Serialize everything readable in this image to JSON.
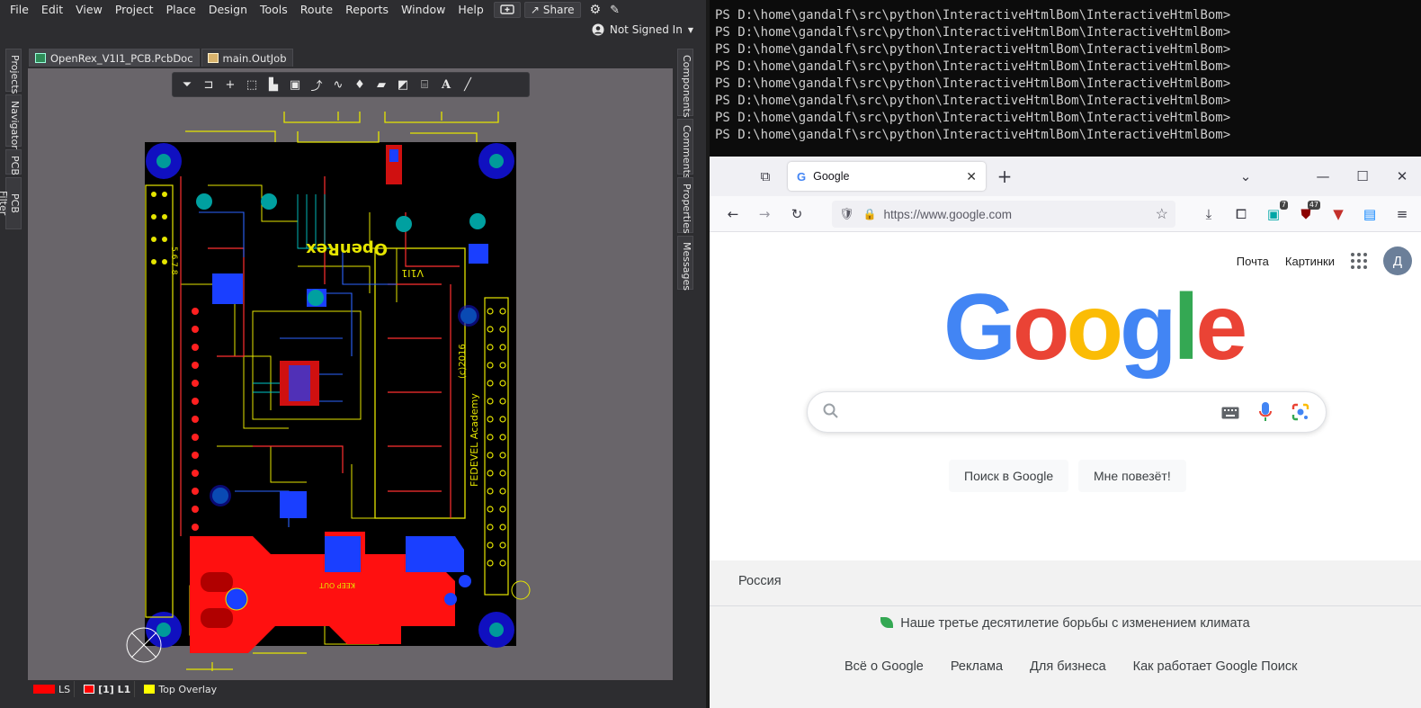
{
  "altium": {
    "menu": [
      "File",
      "Edit",
      "View",
      "Project",
      "Place",
      "Design",
      "Tools",
      "Route",
      "Reports",
      "Window",
      "Help"
    ],
    "share_label": "Share",
    "signin_label": "Not Signed In",
    "left_panels": [
      "Projects",
      "Navigator",
      "PCB",
      "PCB Filter"
    ],
    "right_panels": [
      "Components",
      "Comments",
      "Properties",
      "Messages"
    ],
    "doc_tabs": [
      "OpenRex_V1I1_PCB.PcbDoc",
      "main.OutJob"
    ],
    "pcb_text": {
      "board_name": "OpenRex",
      "version": "V1I1",
      "credit_line1": "FEDEVEL Academy",
      "credit_line2": "(c)2016",
      "keep_out": "KEEP OUT",
      "pin_digits": "5 6 7 8"
    },
    "layers": [
      {
        "label": "LS",
        "color": "#ff0000"
      },
      {
        "label": "[1] L1",
        "color": "#ff0000"
      },
      {
        "label": "Top Overlay",
        "color": "#ffff00"
      }
    ]
  },
  "terminal": {
    "lines": [
      "PS D:\\home\\gandalf\\src\\python\\InteractiveHtmlBom\\InteractiveHtmlBom>",
      "PS D:\\home\\gandalf\\src\\python\\InteractiveHtmlBom\\InteractiveHtmlBom>",
      "PS D:\\home\\gandalf\\src\\python\\InteractiveHtmlBom\\InteractiveHtmlBom>",
      "PS D:\\home\\gandalf\\src\\python\\InteractiveHtmlBom\\InteractiveHtmlBom>",
      "PS D:\\home\\gandalf\\src\\python\\InteractiveHtmlBom\\InteractiveHtmlBom>",
      "PS D:\\home\\gandalf\\src\\python\\InteractiveHtmlBom\\InteractiveHtmlBom>",
      "PS D:\\home\\gandalf\\src\\python\\InteractiveHtmlBom\\InteractiveHtmlBom>",
      "PS D:\\home\\gandalf\\src\\python\\InteractiveHtmlBom\\InteractiveHtmlBom>"
    ]
  },
  "firefox": {
    "tab_title": "Google",
    "url": "https://www.google.com",
    "extension_badges": {
      "first": "7",
      "second": "47"
    }
  },
  "google": {
    "top_links": [
      "Почта",
      "Картинки"
    ],
    "avatar_letter": "Д",
    "logo_letters": [
      {
        "ch": "G",
        "color": "#4285F4"
      },
      {
        "ch": "o",
        "color": "#EA4335"
      },
      {
        "ch": "o",
        "color": "#FBBC05"
      },
      {
        "ch": "g",
        "color": "#4285F4"
      },
      {
        "ch": "l",
        "color": "#34A853"
      },
      {
        "ch": "e",
        "color": "#EA4335"
      }
    ],
    "search_button": "Поиск в Google",
    "lucky_button": "Мне повезёт!",
    "country": "Россия",
    "climate": "Наше третье десятилетие борьбы с изменением климата",
    "footer_links": [
      "Всё о Google",
      "Реклама",
      "Для бизнеса",
      "Как работает Google Поиск"
    ]
  }
}
